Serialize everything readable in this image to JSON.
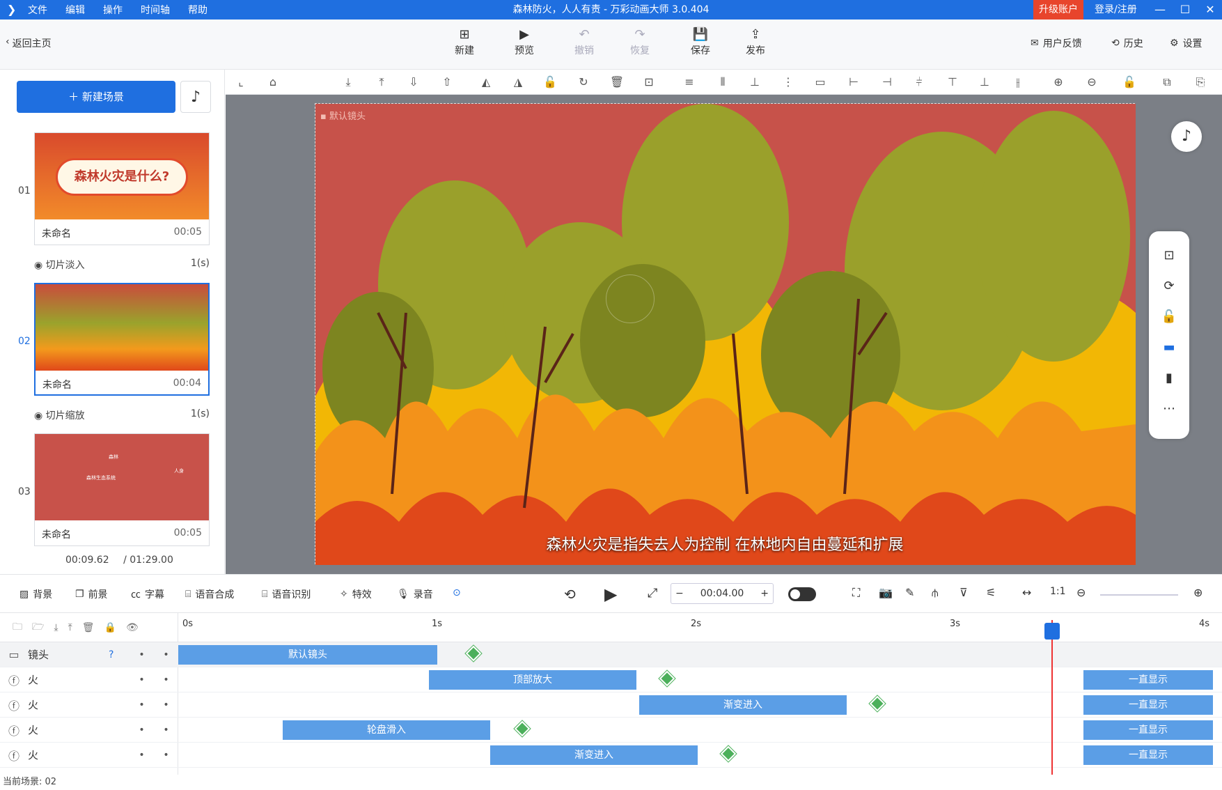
{
  "titlebar": {
    "menu": [
      "文件",
      "编辑",
      "操作",
      "时间轴",
      "帮助"
    ],
    "title": "森林防火，人人有责 - 万彩动画大师 3.0.404",
    "upgrade": "升级账户",
    "login": "登录/注册",
    "brand_color": "#1f6fe0"
  },
  "toolbar": {
    "back": "返回主页",
    "new": "新建",
    "preview": "预览",
    "undo": "撤销",
    "redo": "恢复",
    "save": "保存",
    "publish": "发布",
    "feedback": "用户反馈",
    "history": "历史",
    "settings": "设置"
  },
  "left": {
    "new_scene": "新建场景",
    "scenes": [
      {
        "num": "01",
        "name": "未命名",
        "duration": "00:05",
        "thumb_text": "森林火灾是什么?"
      },
      {
        "num": "02",
        "name": "未命名",
        "duration": "00:04"
      },
      {
        "num": "03",
        "name": "未命名",
        "duration": "00:05",
        "thumb_lines": [
          "森林",
          "人身",
          "森林生态系统"
        ]
      }
    ],
    "transitions": [
      {
        "label": "切片淡入",
        "duration": "1(s)"
      },
      {
        "label": "切片缩放",
        "duration": "1(s)"
      }
    ],
    "time_current": "00:09.62",
    "time_total": "/ 01:29.00"
  },
  "canvas": {
    "camera_label": "默认镜头",
    "subtitle": "森林火灾是指失去人为控制 在林地内自由蔓延和扩展"
  },
  "bottom": {
    "tools": [
      "背景",
      "前景",
      "字幕",
      "语音合成",
      "语音识别",
      "特效",
      "录音"
    ],
    "time": "00:04.00"
  },
  "timeline": {
    "ticks": [
      "0s",
      "1s",
      "2s",
      "3s",
      "4s"
    ],
    "tracks": [
      {
        "label": "镜头",
        "clips": [
          {
            "label": "默认镜头"
          }
        ]
      },
      {
        "label": "火",
        "clips": [
          {
            "label": "顶部放大"
          },
          {
            "label": "一直显示"
          }
        ]
      },
      {
        "label": "火",
        "clips": [
          {
            "label": "渐变进入"
          },
          {
            "label": "一直显示"
          }
        ]
      },
      {
        "label": "火",
        "clips": [
          {
            "label": "轮盘滑入"
          },
          {
            "label": "一直显示"
          }
        ]
      },
      {
        "label": "火",
        "clips": [
          {
            "label": "渐变进入"
          },
          {
            "label": "一直显示"
          }
        ]
      }
    ],
    "status": "当前场景: 02"
  }
}
